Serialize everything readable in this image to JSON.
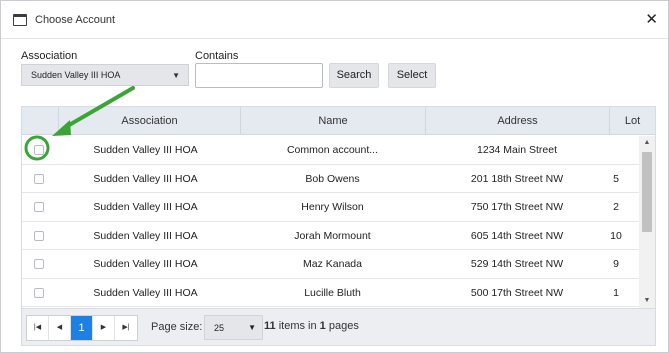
{
  "dialog": {
    "title": "Choose Account",
    "close_icon": "close-icon",
    "window_icon": "window-icon"
  },
  "filters": {
    "association_label": "Association",
    "association_value": "Sudden Valley III HOA",
    "contains_label": "Contains",
    "contains_value": "",
    "search_label": "Search",
    "select_label": "Select"
  },
  "table": {
    "columns": [
      "",
      "Association",
      "Name",
      "Address",
      "Lot"
    ],
    "rows": [
      {
        "association": "Sudden Valley III HOA",
        "name": "Common account...",
        "address": "1234 Main Street",
        "lot": ""
      },
      {
        "association": "Sudden Valley III HOA",
        "name": "Bob Owens",
        "address": "201 18th Street NW",
        "lot": "5"
      },
      {
        "association": "Sudden Valley III HOA",
        "name": "Henry Wilson",
        "address": "750 17th Street NW",
        "lot": "2"
      },
      {
        "association": "Sudden Valley III HOA",
        "name": "Jorah Mormount",
        "address": "605 14th Street NW",
        "lot": "10"
      },
      {
        "association": "Sudden Valley III HOA",
        "name": "Maz Kanada",
        "address": "529 14th Street NW",
        "lot": "9"
      },
      {
        "association": "Sudden Valley III HOA",
        "name": "Lucille Bluth",
        "address": "500 17th Street NW",
        "lot": "1"
      }
    ]
  },
  "pager": {
    "current_page": "1",
    "page_size_label": "Page size:",
    "page_size_value": "25",
    "items_count": "11",
    "items_in": "items in",
    "pages_count": "1",
    "pages_label": "pages"
  },
  "annotation": {
    "highlight_color": "#3aa534"
  }
}
